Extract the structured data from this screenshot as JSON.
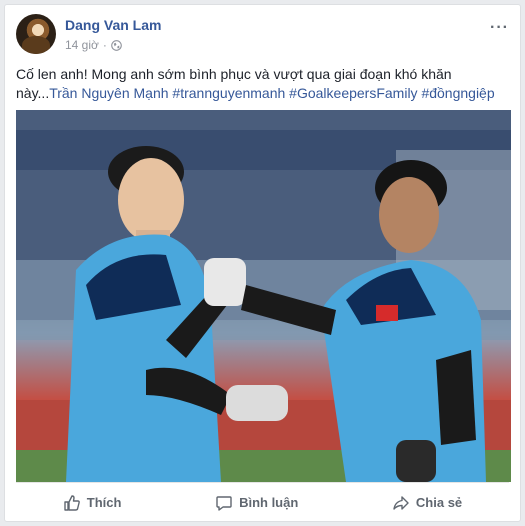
{
  "post": {
    "author": "Dang Van Lam",
    "time": "14 giờ",
    "separator": "·",
    "more_label": "···",
    "text_plain": "Cố len anh! Mong anh sớm bình phục và vượt qua giai đoạn khó khăn này...",
    "mention": "Trần Nguyên Mạnh",
    "hashtags": "#trannguyenmanh #GoalkeepersFamily #đồngngiệp"
  },
  "actions": {
    "like": "Thích",
    "comment": "Bình luận",
    "share": "Chia sẻ"
  },
  "icons": {
    "privacy": "globe-icon",
    "options": "more-options-icon",
    "like": "thumbs-up-icon",
    "comment": "comment-bubble-icon",
    "share": "share-arrow-icon"
  },
  "colors": {
    "link": "#365899",
    "meta": "#90949c",
    "action": "#606770"
  }
}
